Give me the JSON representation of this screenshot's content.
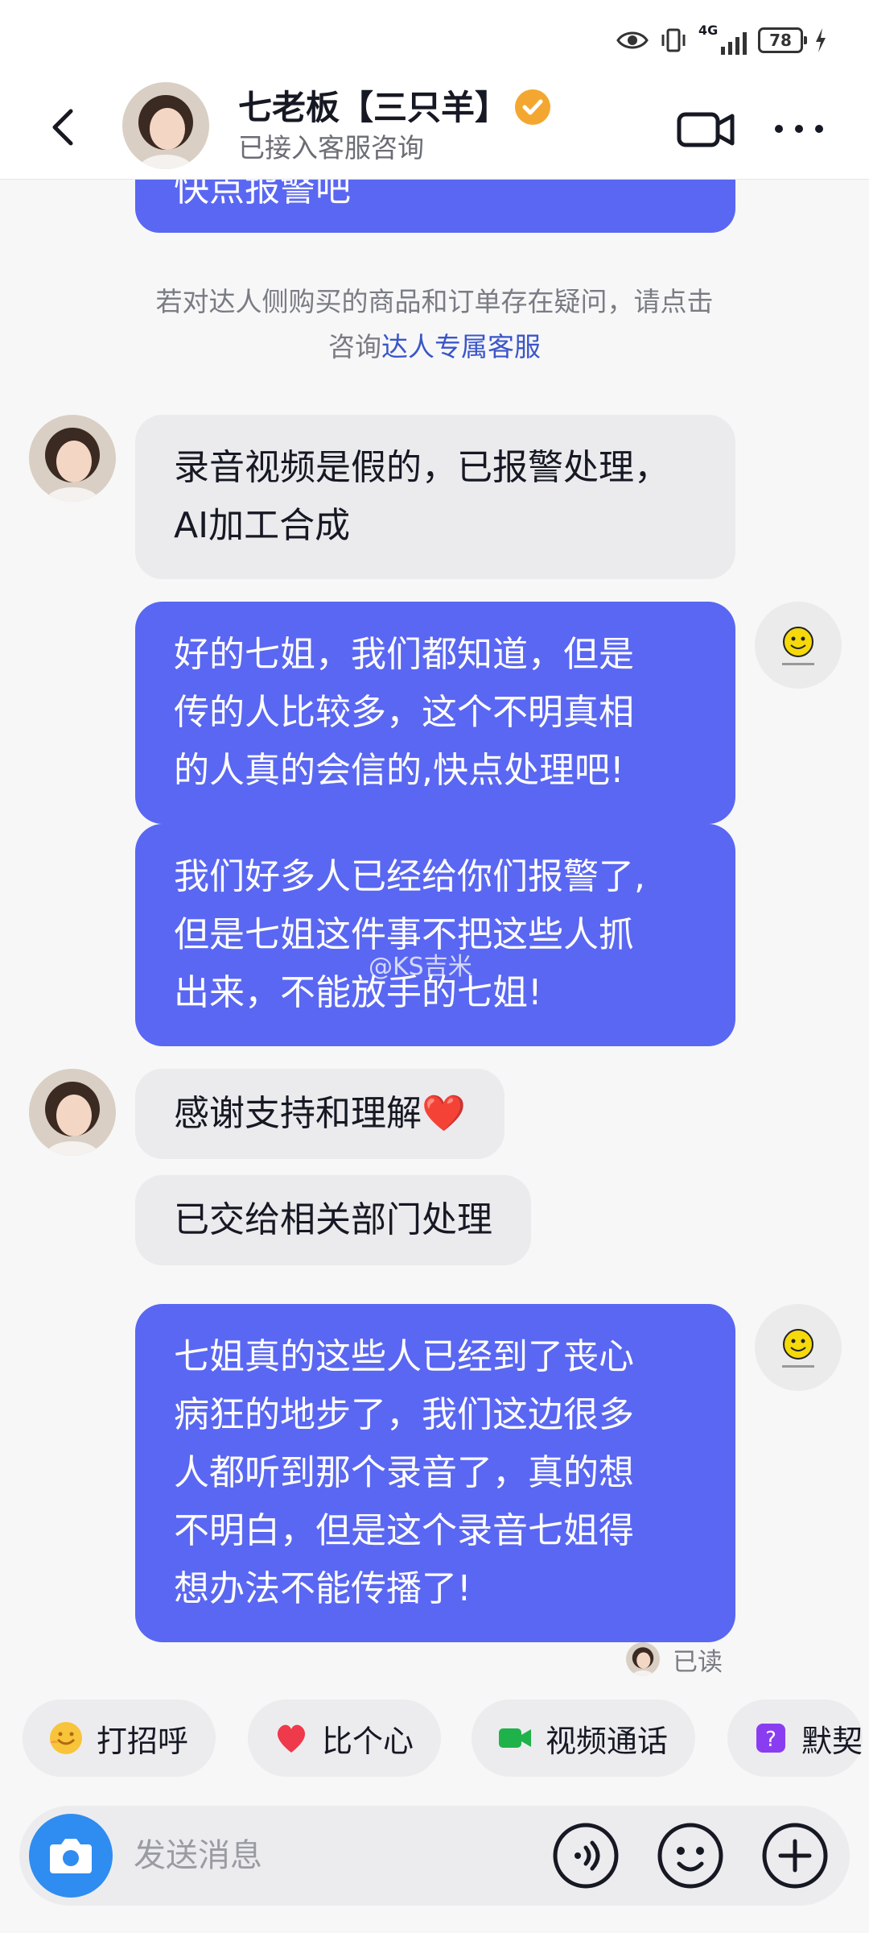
{
  "status_bar": {
    "network": "4G",
    "battery": "78"
  },
  "header": {
    "title": "七老板【三只羊】",
    "subtitle": "已接入客服咨询"
  },
  "chat": {
    "top_partial_message": "快点报警吧",
    "notice": {
      "text": "若对达人侧购买的商品和订单存在疑问，请点击",
      "line2_prefix": "咨询",
      "link": "达人专属客服"
    },
    "messages": [
      {
        "from": "them",
        "lines": [
          "录音视频是假的，已报警处理，",
          "AI加工合成"
        ]
      },
      {
        "from": "me",
        "lines": [
          "好的七姐，我们都知道，但是",
          "传的人比较多，这个不明真相",
          "的人真的会信的,快点处理吧!"
        ]
      },
      {
        "from": "me",
        "lines": [
          "我们好多人已经给你们报警了,",
          "但是七姐这件事不把这些人抓",
          "出来，不能放手的七姐!"
        ]
      },
      {
        "from": "them",
        "lines": [
          "感谢支持和理解❤️"
        ]
      },
      {
        "from": "them",
        "lines": [
          "已交给相关部门处理"
        ]
      },
      {
        "from": "me",
        "lines": [
          "七姐真的这些人已经到了丧心",
          "病狂的地步了，我们这边很多",
          "人都听到那个录音了，真的想",
          "不明白，但是这个录音七姐得",
          "想办法不能传播了!"
        ]
      }
    ],
    "watermark": "@KS吉米",
    "read_status": "已读"
  },
  "quick_actions": [
    {
      "label": "打招呼",
      "icon": "wave-hand-icon"
    },
    {
      "label": "比个心",
      "icon": "heart-icon"
    },
    {
      "label": "视频通话",
      "icon": "video-call-icon"
    },
    {
      "label": "默契",
      "icon": "question-box-icon"
    }
  ],
  "input_bar": {
    "placeholder": "发送消息"
  },
  "colors": {
    "my_bubble": "#5a67f2",
    "their_bubble": "#ebebee",
    "link": "#3a56c8",
    "camera_button": "#2f8cf1"
  }
}
